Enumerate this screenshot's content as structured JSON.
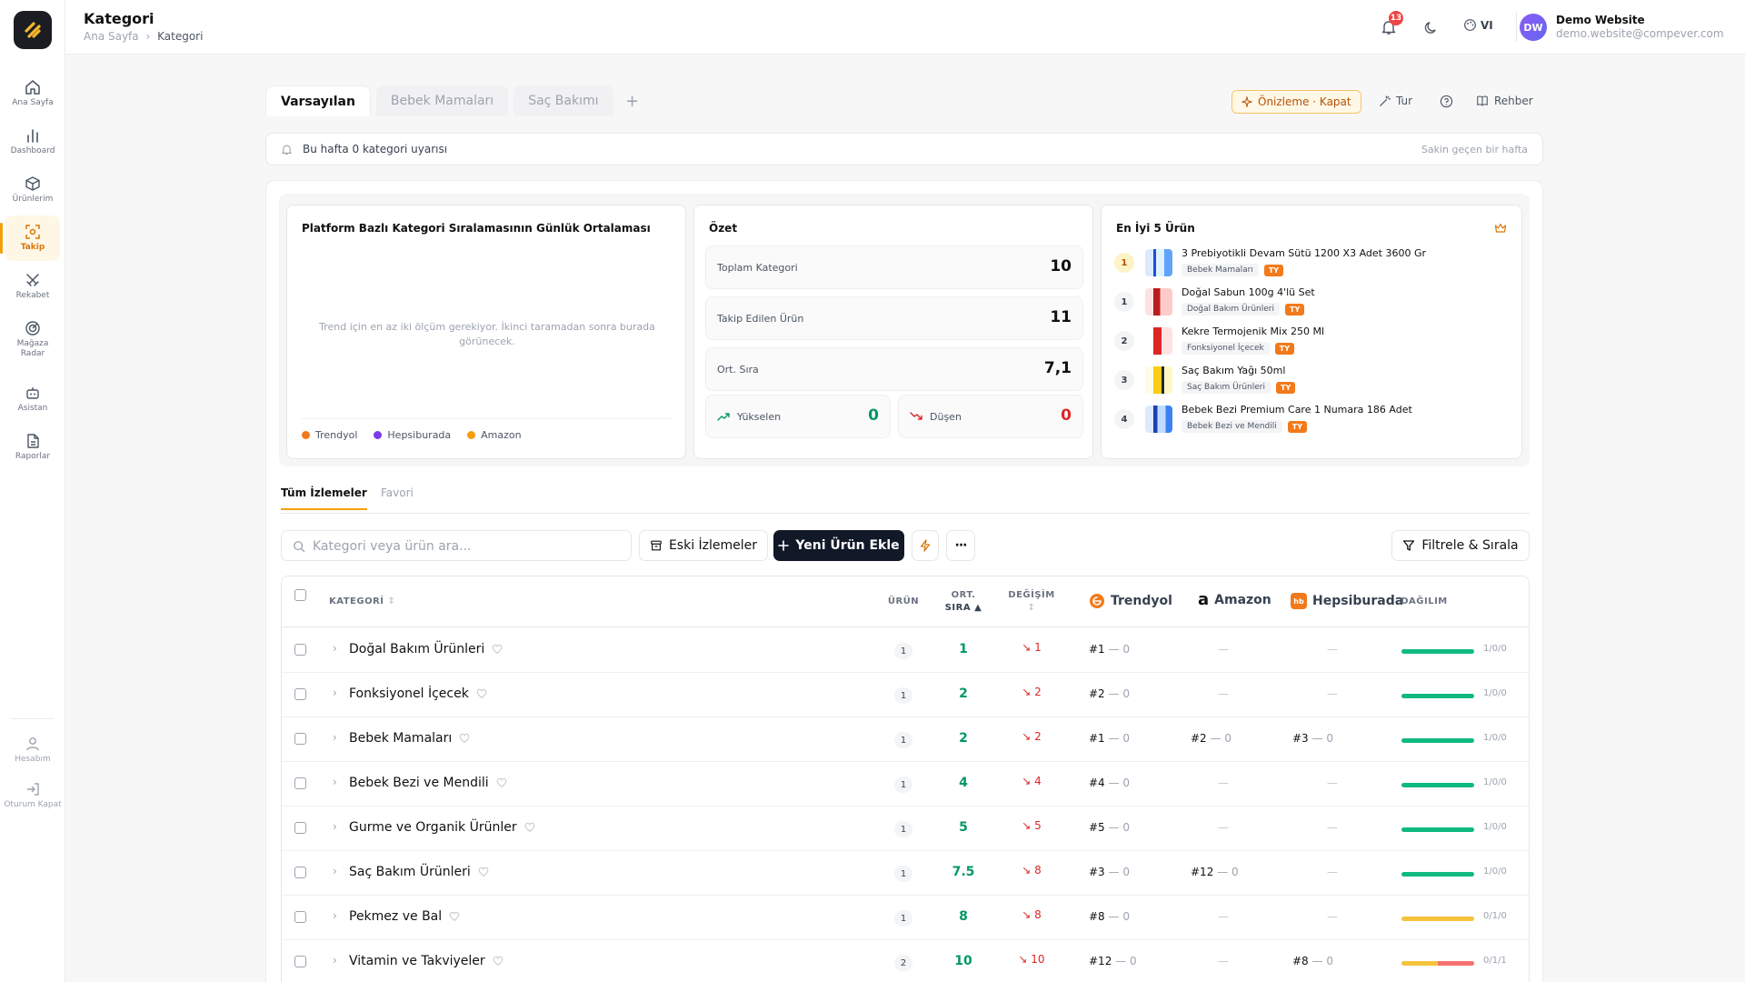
{
  "header": {
    "title": "Kategori",
    "breadcrumb_home": "Ana Sayfa",
    "breadcrumb_sep": "›",
    "breadcrumb_current": "Kategori",
    "notifications": "13",
    "lang": "VI",
    "user_initials": "DW",
    "user_name": "Demo Website",
    "user_email": "demo.website@compever.com"
  },
  "sidebar": {
    "items": [
      {
        "label": "Ana Sayfa"
      },
      {
        "label": "Dashboard"
      },
      {
        "label": "Ürünlerim"
      },
      {
        "label": "Takip"
      },
      {
        "label": "Rekabet"
      },
      {
        "label": "Mağaza Radar"
      },
      {
        "label": "Asistan"
      },
      {
        "label": "Raporlar"
      }
    ],
    "bottom": [
      {
        "label": "Hesabım"
      },
      {
        "label": "Oturum Kapat"
      }
    ]
  },
  "view_tabs": [
    "Varsayılan",
    "Bebek Mamaları",
    "Saç Bakımı"
  ],
  "view_tab_add": "+",
  "toolbar_top": {
    "preview": "Önizleme · Kapat",
    "tour": "Tur",
    "guide": "Rehber"
  },
  "alert": {
    "text": "Bu hafta 0 kategori uyarısı",
    "right": "Sakin geçen bir hafta"
  },
  "trend_panel": {
    "title": "Platform Bazlı Kategori Sıralamasının Günlük Ortalaması",
    "empty": "Trend için en az iki ölçüm gerekiyor. İkinci taramadan sonra burada görünecek.",
    "legend": [
      {
        "name": "Trendyol",
        "color": "#f27a1a"
      },
      {
        "name": "Hepsiburada",
        "color": "#7c3aed"
      },
      {
        "name": "Amazon",
        "color": "#f59e0b"
      }
    ]
  },
  "summary": {
    "title": "Özet",
    "total_label": "Toplam Kategori",
    "total_value": "10",
    "tracked_label": "Takip Edilen Ürün",
    "tracked_value": "11",
    "avg_label": "Ort. Sıra",
    "avg_value": "7,1",
    "up_label": "Yükselen",
    "up_value": "0",
    "down_label": "Düşen",
    "down_value": "0"
  },
  "top5": {
    "title": "En İyi 5 Ürün",
    "items": [
      {
        "rank": "1",
        "name": "3 Prebiyotikli Devam Sütü 1200 X3 Adet 3600 Gr",
        "category": "Bebek Mamaları",
        "tag": "TY"
      },
      {
        "rank": "1",
        "name": "Doğal Sabun 100g 4'lü Set",
        "category": "Doğal Bakım Ürünleri",
        "tag": "TY"
      },
      {
        "rank": "2",
        "name": "Kekre Termojenik Mix 250 Ml",
        "category": "Fonksiyonel İçecek",
        "tag": "TY"
      },
      {
        "rank": "3",
        "name": "Saç Bakım Yağı 50ml",
        "category": "Saç Bakım Ürünleri",
        "tag": "TY"
      },
      {
        "rank": "4",
        "name": "Bebek Bezi Premium Care 1 Numara 186 Adet",
        "category": "Bebek Bezi ve Mendili",
        "tag": "TY"
      }
    ]
  },
  "subtabs": [
    "Tüm İzlemeler",
    "Favori"
  ],
  "list_toolbar": {
    "search_placeholder": "Kategori veya ürün ara...",
    "old_label": "Eski İzlemeler",
    "new_label": "Yeni Ürün Ekle",
    "more": "···",
    "filter_label": "Filtrele & Sırala"
  },
  "table": {
    "headers": {
      "category": "KATEGORİ",
      "product": "ÜRÜN",
      "avg_line1": "ORT.",
      "avg_line2": "SIRA ▲",
      "change": "DEĞİŞİM",
      "trendyol": "Trendyol",
      "amazon": "Amazon",
      "hepsiburada": "Hepsiburada",
      "dist": "DAĞILIM"
    },
    "rows": [
      {
        "name": "Doğal Bakım Ürünleri",
        "count": "1",
        "avg": "1",
        "change": "↘ 1",
        "ty": "#1",
        "ty_d": "— 0",
        "am": "—",
        "am_d": "",
        "hb": "—",
        "hb_d": "",
        "dist": "1/0/0"
      },
      {
        "name": "Fonksiyonel İçecek",
        "count": "1",
        "avg": "2",
        "change": "↘ 2",
        "ty": "#2",
        "ty_d": "— 0",
        "am": "—",
        "am_d": "",
        "hb": "—",
        "hb_d": "",
        "dist": "1/0/0"
      },
      {
        "name": "Bebek Mamaları",
        "count": "1",
        "avg": "2",
        "change": "↘ 2",
        "ty": "#1",
        "ty_d": "— 0",
        "am": "#2",
        "am_d": "— 0",
        "hb": "#3",
        "hb_d": "— 0",
        "dist": "1/0/0"
      },
      {
        "name": "Bebek Bezi ve Mendili",
        "count": "1",
        "avg": "4",
        "change": "↘ 4",
        "ty": "#4",
        "ty_d": "— 0",
        "am": "—",
        "am_d": "",
        "hb": "—",
        "hb_d": "",
        "dist": "1/0/0"
      },
      {
        "name": "Gurme ve Organik Ürünler",
        "count": "1",
        "avg": "5",
        "change": "↘ 5",
        "ty": "#5",
        "ty_d": "— 0",
        "am": "—",
        "am_d": "",
        "hb": "—",
        "hb_d": "",
        "dist": "1/0/0"
      },
      {
        "name": "Saç Bakım Ürünleri",
        "count": "1",
        "avg": "7.5",
        "change": "↘ 8",
        "ty": "#3",
        "ty_d": "— 0",
        "am": "#12",
        "am_d": "— 0",
        "hb": "—",
        "hb_d": "",
        "dist": "1/0/0"
      },
      {
        "name": "Pekmez ve Bal",
        "count": "1",
        "avg": "8",
        "change": "↘ 8",
        "ty": "#8",
        "ty_d": "— 0",
        "am": "—",
        "am_d": "",
        "hb": "—",
        "hb_d": "",
        "dist": "0/1/0"
      },
      {
        "name": "Vitamin ve Takviyeler",
        "count": "2",
        "avg": "10",
        "change": "↘ 10",
        "ty": "#12",
        "ty_d": "— 0",
        "am": "—",
        "am_d": "",
        "hb": "#8",
        "hb_d": "— 0",
        "dist": "0/1/1"
      }
    ]
  }
}
